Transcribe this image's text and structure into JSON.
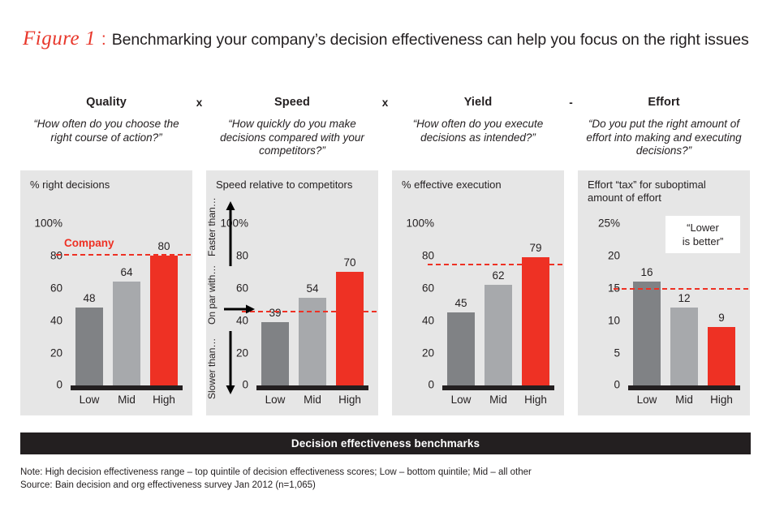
{
  "figure": {
    "label": "Figure 1",
    "colon": ":",
    "title": "Benchmarking your company’s decision effectiveness can help you focus on the right issues"
  },
  "headers": [
    {
      "name": "Quality",
      "question": "“How often do you choose the right course of action?”",
      "operator": "x"
    },
    {
      "name": "Speed",
      "question": "“How quickly do you make decisions compared with your competitors?”",
      "operator": "x"
    },
    {
      "name": "Yield",
      "question": "“How often do you execute decisions as intended?”",
      "operator": "-"
    },
    {
      "name": "Effort",
      "question": "“Do you put the right amount of effort into making and executing decisions?”",
      "operator": ""
    }
  ],
  "panels": [
    {
      "axis_title": "% right decisions",
      "ticks": [
        "100%",
        "80",
        "60",
        "40",
        "20",
        "0"
      ],
      "categories": [
        "Low",
        "Mid",
        "High"
      ],
      "values": [
        48,
        64,
        80
      ],
      "value_labels": [
        "48",
        "64",
        "80"
      ],
      "company_label": "Company",
      "company_value": 81
    },
    {
      "axis_title": "Speed relative to competitors",
      "ticks": [
        "100%",
        "80",
        "60",
        "40",
        "20",
        "0"
      ],
      "categories": [
        "Low",
        "Mid",
        "High"
      ],
      "values": [
        39,
        54,
        70
      ],
      "value_labels": [
        "39",
        "54",
        "70"
      ],
      "company_label": "",
      "company_value": 46,
      "scale_labels": [
        "Faster than…",
        "On par with…",
        "Slower than…"
      ]
    },
    {
      "axis_title": "% effective execution",
      "ticks": [
        "100%",
        "80",
        "60",
        "40",
        "20",
        "0"
      ],
      "categories": [
        "Low",
        "Mid",
        "High"
      ],
      "values": [
        45,
        62,
        79
      ],
      "value_labels": [
        "45",
        "62",
        "79"
      ],
      "company_label": "",
      "company_value": 75
    },
    {
      "axis_title": "Effort “tax” for suboptimal amount of effort",
      "ticks": [
        "25%",
        "20",
        "15",
        "10",
        "5",
        "0"
      ],
      "categories": [
        "Low",
        "Mid",
        "High"
      ],
      "values": [
        16,
        12,
        9
      ],
      "value_labels": [
        "16",
        "12",
        "9"
      ],
      "company_label": "",
      "company_value": 15,
      "callout": [
        "“Lower",
        "is better”"
      ]
    }
  ],
  "footer_bar": "Decision effectiveness benchmarks",
  "notes": {
    "line1": "Note: High decision effectiveness range – top quintile of decision effectiveness scores; Low – bottom quintile; Mid – all other",
    "line2": "Source: Bain decision and org effectiveness survey Jan 2012 (n=1,065)"
  },
  "colors": {
    "accent_red": "#ee3124",
    "bar_low": "#808285",
    "bar_mid": "#a7a9ac",
    "bar_high": "#ee3124",
    "panel_bg": "#e6e6e6",
    "dark": "#231f20"
  },
  "chart_data": {
    "type": "bar",
    "title": "Benchmarking your company’s decision effectiveness can help you focus on the right issues",
    "categories": [
      "Low",
      "Mid",
      "High"
    ],
    "panels": [
      {
        "name": "Quality",
        "question": "“How often do you choose the right course of action?”",
        "ylabel": "% right decisions",
        "ylim": [
          0,
          100
        ],
        "yticks": [
          0,
          20,
          40,
          60,
          80,
          100
        ],
        "values": [
          48,
          64,
          80
        ],
        "reference_line": {
          "label": "Company",
          "value": 81,
          "style": "dashed",
          "color": "#ee3124"
        }
      },
      {
        "name": "Speed",
        "question": "“How quickly do you make decisions compared with your competitors?”",
        "ylabel": "Speed relative to competitors",
        "ylim": [
          0,
          100
        ],
        "yticks": [
          0,
          20,
          40,
          60,
          80,
          100
        ],
        "values": [
          39,
          54,
          70
        ],
        "reference_line": {
          "label": "",
          "value": 46,
          "style": "dashed",
          "color": "#ee3124"
        },
        "annotations": [
          "Faster than…",
          "On par with…",
          "Slower than…"
        ]
      },
      {
        "name": "Yield",
        "question": "“How often do you execute decisions as intended?”",
        "ylabel": "% effective execution",
        "ylim": [
          0,
          100
        ],
        "yticks": [
          0,
          20,
          40,
          60,
          80,
          100
        ],
        "values": [
          45,
          62,
          79
        ],
        "reference_line": {
          "label": "",
          "value": 75,
          "style": "dashed",
          "color": "#ee3124"
        }
      },
      {
        "name": "Effort",
        "question": "“Do you put the right amount of effort into making and executing decisions?”",
        "ylabel": "Effort “tax” for suboptimal amount of effort",
        "ylim": [
          0,
          25
        ],
        "yticks": [
          0,
          5,
          10,
          15,
          20,
          25
        ],
        "values": [
          16,
          12,
          9
        ],
        "reference_line": {
          "label": "",
          "value": 15,
          "style": "dashed",
          "color": "#ee3124"
        },
        "annotations": [
          "“Lower is better”"
        ]
      }
    ],
    "series_colors": {
      "Low": "#808285",
      "Mid": "#a7a9ac",
      "High": "#ee3124"
    },
    "grid": false,
    "legend": "none",
    "footer": "Decision effectiveness benchmarks",
    "note": "High decision effectiveness range – top quintile of decision effectiveness scores; Low – bottom quintile; Mid – all other",
    "source": "Bain decision and org effectiveness survey Jan 2012 (n=1,065)"
  }
}
